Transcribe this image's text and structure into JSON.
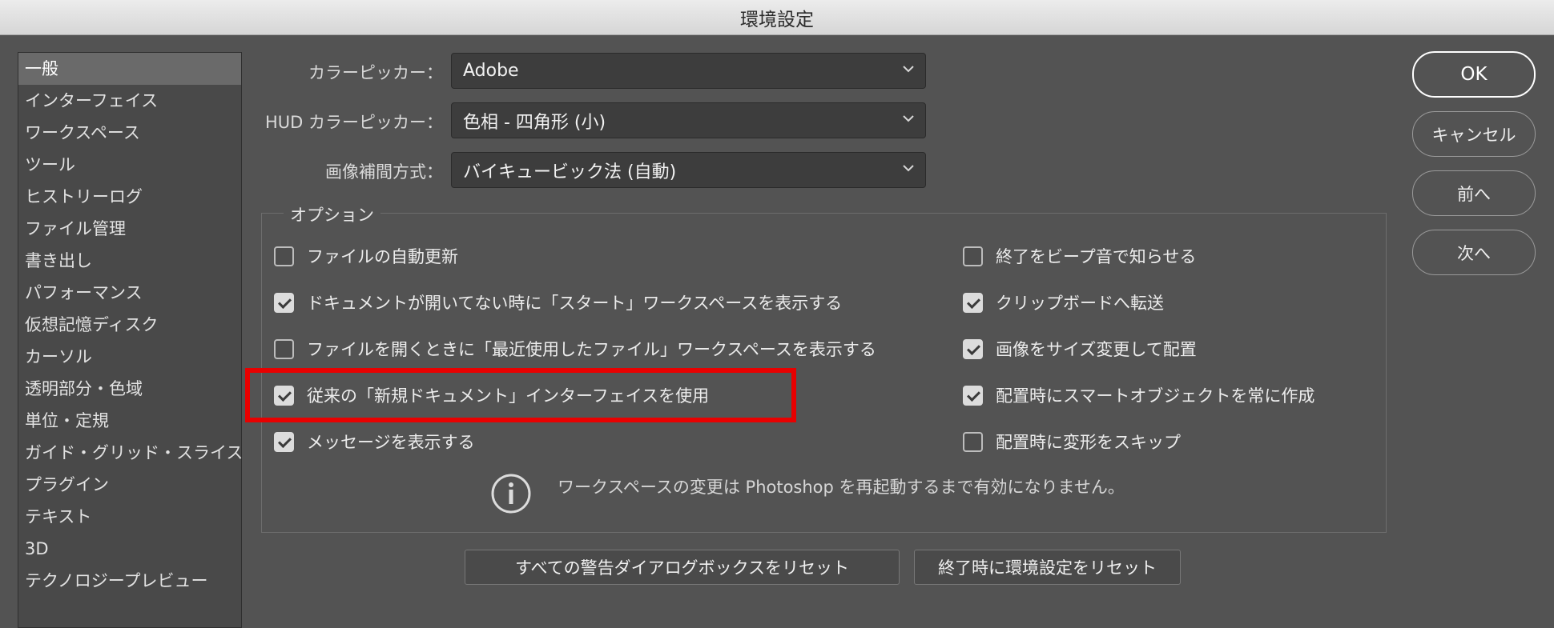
{
  "window": {
    "title": "環境設定"
  },
  "sidebar": {
    "items": [
      {
        "label": "一般",
        "selected": true
      },
      {
        "label": "インターフェイス"
      },
      {
        "label": "ワークスペース"
      },
      {
        "label": "ツール"
      },
      {
        "label": "ヒストリーログ"
      },
      {
        "label": "ファイル管理"
      },
      {
        "label": "書き出し"
      },
      {
        "label": "パフォーマンス"
      },
      {
        "label": "仮想記憶ディスク"
      },
      {
        "label": "カーソル"
      },
      {
        "label": "透明部分・色域"
      },
      {
        "label": "単位・定規"
      },
      {
        "label": "ガイド・グリッド・スライス"
      },
      {
        "label": "プラグイン"
      },
      {
        "label": "テキスト"
      },
      {
        "label": "3D"
      },
      {
        "label": "テクノロジープレビュー"
      }
    ]
  },
  "settings": {
    "color_picker": {
      "label": "カラーピッカー：",
      "value": "Adobe"
    },
    "hud_color_picker": {
      "label": "HUD カラーピッカー：",
      "value": "色相 - 四角形 (小)"
    },
    "interpolation": {
      "label": "画像補間方式：",
      "value": "バイキュービック法 (自動)"
    }
  },
  "options": {
    "legend": "オプション",
    "left": [
      {
        "label": "ファイルの自動更新",
        "checked": false
      },
      {
        "label": "ドキュメントが開いてない時に「スタート」ワークスペースを表示する",
        "checked": true
      },
      {
        "label": "ファイルを開くときに「最近使用したファイル」ワークスペースを表示する",
        "checked": false
      },
      {
        "label": "従来の「新規ドキュメント」インターフェイスを使用",
        "checked": true
      },
      {
        "label": "メッセージを表示する",
        "checked": true
      }
    ],
    "right": [
      {
        "label": "終了をビープ音で知らせる",
        "checked": false
      },
      {
        "label": "クリップボードへ転送",
        "checked": true
      },
      {
        "label": "画像をサイズ変更して配置",
        "checked": true
      },
      {
        "label": "配置時にスマートオブジェクトを常に作成",
        "checked": true
      },
      {
        "label": "配置時に変形をスキップ",
        "checked": false
      }
    ],
    "info": "ワークスペースの変更は Photoshop を再起動するまで有効になりません。"
  },
  "reset_buttons": {
    "warnings": "すべての警告ダイアログボックスをリセット",
    "on_quit": "終了時に環境設定をリセット"
  },
  "dialog_buttons": {
    "ok": "OK",
    "cancel": "キャンセル",
    "prev": "前へ",
    "next": "次へ"
  },
  "colors": {
    "background": "#535353",
    "highlight": "#e80000"
  }
}
